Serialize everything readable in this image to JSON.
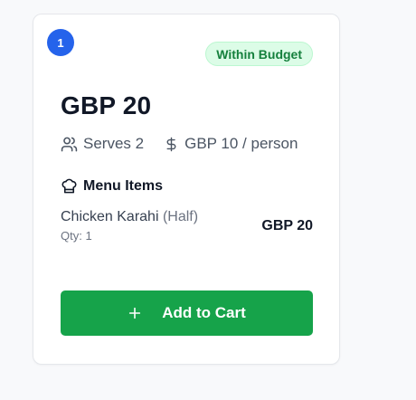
{
  "card": {
    "rank": "1",
    "status_label": "Within Budget",
    "price": "GBP 20",
    "serves_label": "Serves 2",
    "per_person_label": "GBP 10 / person",
    "menu_heading": "Menu Items",
    "items": [
      {
        "name": "Chicken Karahi",
        "variant": "(Half)",
        "qty": "Qty: 1",
        "price": "GBP 20"
      }
    ],
    "add_to_cart_label": "Add to Cart"
  },
  "icons": {
    "serves": "users-icon",
    "per_person": "dollar-icon",
    "menu": "chef-hat-icon",
    "add": "plus-icon"
  },
  "colors": {
    "rank_badge": "#2563eb",
    "status_bg": "#dcfce7",
    "status_text": "#15803d",
    "button": "#16a34a"
  }
}
